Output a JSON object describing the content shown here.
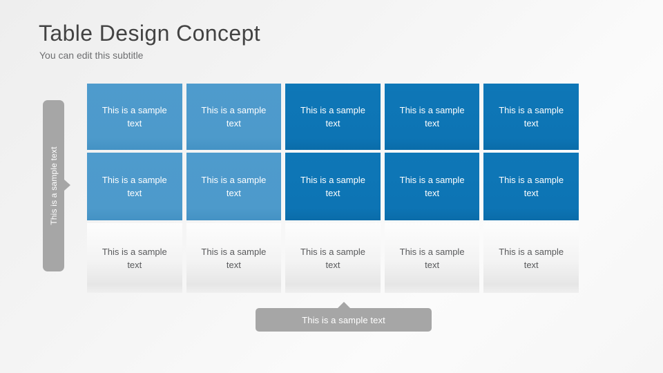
{
  "slide": {
    "title": "Table Design Concept",
    "subtitle": "You can edit this subtitle"
  },
  "colors": {
    "blue_light": "#4e9bcd",
    "blue_dark": "#0e77b7",
    "gray_callout": "#a6a6a6",
    "title_text": "#434343",
    "subtitle_text": "#6d6e70",
    "body_text": "#58595b",
    "background": "#f4f4f4"
  },
  "left_callout": {
    "label": "This is a sample text",
    "orientation": "vertical-bottom-to-top",
    "arrow": "right"
  },
  "bottom_callout": {
    "label": "This is a sample text",
    "arrow": "up"
  },
  "table": {
    "columns": 5,
    "rows": 3,
    "row_styles": [
      "blue-light",
      "mixed",
      "plain"
    ],
    "cells": [
      [
        {
          "text": "This is a sample text",
          "style": "blue-light"
        },
        {
          "text": "This is a sample text",
          "style": "blue-light"
        },
        {
          "text": "This is a sample text",
          "style": "blue-dark"
        },
        {
          "text": "This is a sample text",
          "style": "blue-dark"
        },
        {
          "text": "This is a sample text",
          "style": "blue-dark"
        }
      ],
      [
        {
          "text": "This is a sample text",
          "style": "blue-light"
        },
        {
          "text": "This is a sample text",
          "style": "blue-light"
        },
        {
          "text": "This is a sample text",
          "style": "blue-dark"
        },
        {
          "text": "This is a sample text",
          "style": "blue-dark"
        },
        {
          "text": "This is a sample text",
          "style": "blue-dark"
        }
      ],
      [
        {
          "text": "This is a sample text",
          "style": "plain"
        },
        {
          "text": "This is a sample text",
          "style": "plain"
        },
        {
          "text": "This is a sample text",
          "style": "plain"
        },
        {
          "text": "This is a sample text",
          "style": "plain"
        },
        {
          "text": "This is a sample text",
          "style": "plain"
        }
      ]
    ]
  }
}
